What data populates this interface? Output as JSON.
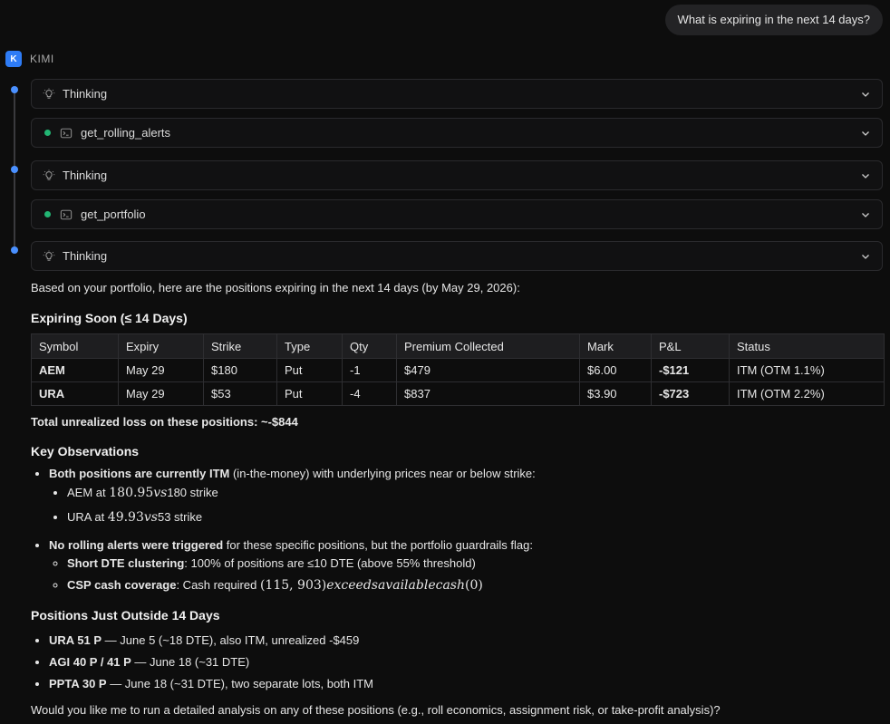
{
  "user_message": "What is expiring in the next 14 days?",
  "agent": {
    "avatar_letter": "K",
    "name": "KIMI"
  },
  "steps": [
    {
      "type": "thinking",
      "label": "Thinking"
    },
    {
      "type": "tool",
      "label": "get_rolling_alerts"
    },
    {
      "type": "thinking",
      "label": "Thinking"
    },
    {
      "type": "tool",
      "label": "get_portfolio"
    },
    {
      "type": "thinking",
      "label": "Thinking"
    }
  ],
  "response": {
    "intro": "Based on your portfolio, here are the positions expiring in the next 14 days (by May 29, 2026):",
    "section1_title": "Expiring Soon (≤ 14 Days)",
    "table": {
      "headers": [
        "Symbol",
        "Expiry",
        "Strike",
        "Type",
        "Qty",
        "Premium Collected",
        "Mark",
        "P&L",
        "Status"
      ],
      "rows": [
        [
          "AEM",
          "May 29",
          "$180",
          "Put",
          "-1",
          "$479",
          "$6.00",
          "-$121",
          "ITM (OTM 1.1%)"
        ],
        [
          "URA",
          "May 29",
          "$53",
          "Put",
          "-4",
          "$837",
          "$3.90",
          "-$723",
          "ITM (OTM 2.2%)"
        ]
      ]
    },
    "total_loss": "Total unrealized loss on these positions: ~-$844",
    "section2_title": "Key Observations",
    "obs1_bold": "Both positions are currently ITM",
    "obs1_rest": " (in-the-money) with underlying prices near or below strike:",
    "obs1_sub1_pre": "AEM at ",
    "obs1_sub1_math_num": "180.95",
    "obs1_sub1_math_it": "vs",
    "obs1_sub1_post": "180 strike",
    "obs1_sub2_pre": "URA at ",
    "obs1_sub2_math_num": "49.93",
    "obs1_sub2_math_it": "vs",
    "obs1_sub2_post": "53 strike",
    "obs2_bold": "No rolling alerts were triggered",
    "obs2_rest": " for these specific positions, but the portfolio guardrails flag:",
    "obs2_sub1_bold": "Short DTE clustering",
    "obs2_sub1_rest": ": 100% of positions are ≤10 DTE (above 55% threshold)",
    "obs2_sub2_bold": "CSP cash coverage",
    "obs2_sub2_rest": ": Cash required ",
    "obs2_sub2_math_a": "(115, 903)",
    "obs2_sub2_math_it": "exceedsavailablecash",
    "obs2_sub2_math_b": "(0)",
    "section3_title": "Positions Just Outside 14 Days",
    "outside": [
      {
        "bold": "URA 51 P",
        "rest": " — June 5 (~18 DTE), also ITM, unrealized -$459"
      },
      {
        "bold": "AGI 40 P / 41 P",
        "rest": " — June 18 (~31 DTE)"
      },
      {
        "bold": "PPTA 30 P",
        "rest": " — June 18 (~31 DTE), two separate lots, both ITM"
      }
    ],
    "closing": "Would you like me to run a detailed analysis on any of these positions (e.g., roll economics, assignment risk, or take-profit analysis)?"
  },
  "colors": {
    "background": "#0d0d0d",
    "accent": "#2e7cf6",
    "success": "#22b573"
  }
}
